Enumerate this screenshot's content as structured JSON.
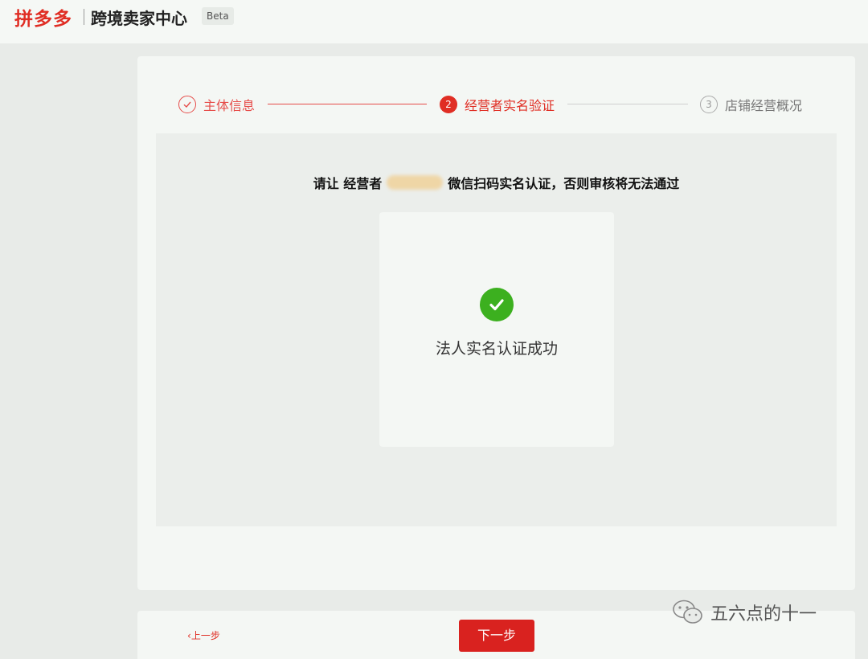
{
  "header": {
    "logo": "拼多多",
    "title": "跨境卖家中心",
    "badge": "Beta"
  },
  "steps": [
    {
      "number": "1",
      "label": "主体信息",
      "state": "done"
    },
    {
      "number": "2",
      "label": "经营者实名验证",
      "state": "active"
    },
    {
      "number": "3",
      "label": "店铺经营概况",
      "state": "pending"
    }
  ],
  "verification": {
    "instruction_prefix": "请让 经营者",
    "instruction_suffix": "微信扫码实名认证，否则审核将无法通过",
    "result_text": "法人实名认证成功",
    "icon": "check-circle-icon"
  },
  "footer": {
    "prev_label": "上一步",
    "next_label": "下一步"
  },
  "watermark": {
    "text": "五六点的十一"
  },
  "colors": {
    "brand": "#e02e24",
    "success": "#3cb01f"
  }
}
